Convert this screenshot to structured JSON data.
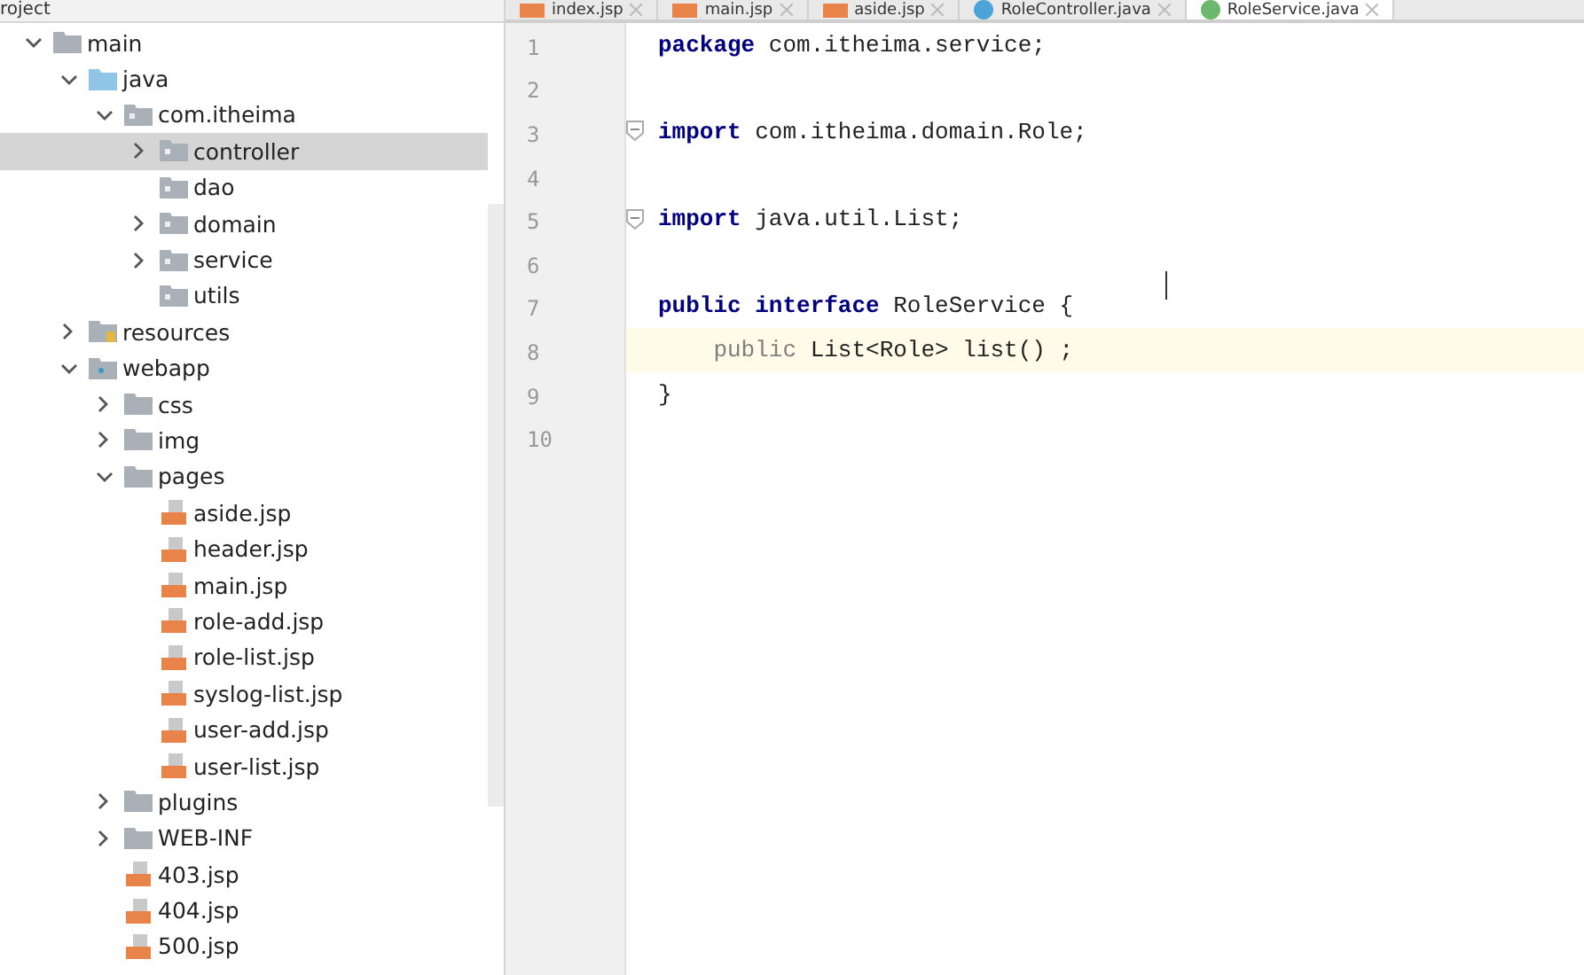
{
  "project_panel": {
    "title": "roject",
    "tree": [
      {
        "name": "main",
        "kind": "folder",
        "expanded": true,
        "selected": false,
        "children": [
          {
            "name": "java",
            "kind": "source",
            "expanded": true,
            "selected": false,
            "children": [
              {
                "name": "com.itheima",
                "kind": "package",
                "expanded": true,
                "selected": false,
                "children": [
                  {
                    "name": "controller",
                    "kind": "package",
                    "expanded": false,
                    "selected": true
                  },
                  {
                    "name": "dao",
                    "kind": "package",
                    "selected": false
                  },
                  {
                    "name": "domain",
                    "kind": "package",
                    "expanded": false,
                    "selected": false
                  },
                  {
                    "name": "service",
                    "kind": "package",
                    "expanded": false,
                    "selected": false
                  },
                  {
                    "name": "utils",
                    "kind": "package",
                    "selected": false
                  }
                ]
              }
            ]
          },
          {
            "name": "resources",
            "kind": "resources",
            "expanded": false,
            "selected": false
          },
          {
            "name": "webapp",
            "kind": "webapp",
            "expanded": true,
            "selected": false,
            "children": [
              {
                "name": "css",
                "kind": "folder",
                "expanded": false,
                "selected": false
              },
              {
                "name": "img",
                "kind": "folder",
                "expanded": false,
                "selected": false
              },
              {
                "name": "pages",
                "kind": "folder",
                "expanded": true,
                "selected": false,
                "children": [
                  {
                    "name": "aside.jsp",
                    "kind": "jsp",
                    "selected": false
                  },
                  {
                    "name": "header.jsp",
                    "kind": "jsp",
                    "selected": false
                  },
                  {
                    "name": "main.jsp",
                    "kind": "jsp",
                    "selected": false
                  },
                  {
                    "name": "role-add.jsp",
                    "kind": "jsp",
                    "selected": false
                  },
                  {
                    "name": "role-list.jsp",
                    "kind": "jsp",
                    "selected": false
                  },
                  {
                    "name": "syslog-list.jsp",
                    "kind": "jsp",
                    "selected": false
                  },
                  {
                    "name": "user-add.jsp",
                    "kind": "jsp",
                    "selected": false
                  },
                  {
                    "name": "user-list.jsp",
                    "kind": "jsp",
                    "selected": false
                  }
                ]
              },
              {
                "name": "plugins",
                "kind": "folder",
                "expanded": false,
                "selected": false
              },
              {
                "name": "WEB-INF",
                "kind": "folder",
                "expanded": false,
                "selected": false
              },
              {
                "name": "403.jsp",
                "kind": "jsp",
                "selected": false
              },
              {
                "name": "404.jsp",
                "kind": "jsp",
                "selected": false
              },
              {
                "name": "500.jsp",
                "kind": "jsp",
                "selected": false
              }
            ]
          }
        ]
      }
    ]
  },
  "editor": {
    "tabs": [
      {
        "label": "index.jsp",
        "kind": "jsp",
        "selected": false
      },
      {
        "label": "main.jsp",
        "kind": "jsp",
        "selected": false
      },
      {
        "label": "aside.jsp",
        "kind": "jsp",
        "selected": false
      },
      {
        "label": "RoleController.java",
        "kind": "class",
        "selected": false
      },
      {
        "label": "RoleService.java",
        "kind": "interface",
        "selected": true
      }
    ],
    "lines": [
      {
        "number": "1",
        "fold": false,
        "current": false,
        "tokens": [
          {
            "text": "package",
            "kind": "keyword"
          },
          {
            "text": " com.itheima.service;",
            "kind": "plain"
          }
        ]
      },
      {
        "number": "2",
        "fold": false,
        "current": false
      },
      {
        "number": "3",
        "fold": true,
        "current": false,
        "tokens": [
          {
            "text": "import",
            "kind": "keyword"
          },
          {
            "text": " com.itheima.domain.Role;",
            "kind": "plain"
          }
        ]
      },
      {
        "number": "4",
        "fold": false,
        "current": false
      },
      {
        "number": "5",
        "fold": true,
        "current": false,
        "tokens": [
          {
            "text": "import",
            "kind": "keyword"
          },
          {
            "text": " java.util.List;",
            "kind": "plain"
          }
        ]
      },
      {
        "number": "6",
        "fold": false,
        "current": false
      },
      {
        "number": "7",
        "fold": false,
        "current": false,
        "tokens": [
          {
            "text": "public interface",
            "kind": "keyword"
          },
          {
            "text": " RoleService {",
            "kind": "plain"
          }
        ]
      },
      {
        "number": "8",
        "fold": false,
        "current": true,
        "tokens": [
          {
            "text": "    public",
            "kind": "dim"
          },
          {
            "text": " List<Role> list() ;",
            "kind": "plain"
          }
        ]
      },
      {
        "number": "9",
        "fold": false,
        "current": false,
        "tokens": [
          {
            "text": "}",
            "kind": "plain"
          }
        ]
      },
      {
        "number": "10",
        "fold": false,
        "current": false
      }
    ]
  }
}
